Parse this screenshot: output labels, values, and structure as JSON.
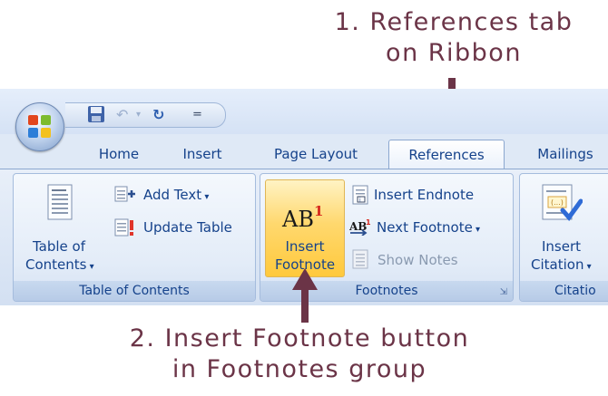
{
  "annotations": {
    "top_line1": "1. References tab",
    "top_line2": "on Ribbon",
    "bottom_line1": "2. Insert Footnote button",
    "bottom_line2": "in Footnotes group"
  },
  "qat": {
    "save_icon": "save-icon",
    "undo_icon": "undo-icon",
    "redo_icon": "redo-icon",
    "customize_glyph": "="
  },
  "tabs": [
    {
      "label": "Home"
    },
    {
      "label": "Insert"
    },
    {
      "label": "Page Layout"
    },
    {
      "label": "References"
    },
    {
      "label": "Mailings"
    }
  ],
  "active_tab": "References",
  "groups": {
    "toc": {
      "label": "Table of Contents",
      "toc_button_line1": "Table of",
      "toc_button_line2": "Contents",
      "add_text": "Add Text",
      "update_table": "Update Table"
    },
    "footnotes": {
      "label": "Footnotes",
      "insert_footnote_line1": "Insert",
      "insert_footnote_line2": "Footnote",
      "insert_footnote_icon_text": "AB",
      "insert_footnote_icon_sup": "1",
      "insert_endnote": "Insert Endnote",
      "next_footnote": "Next Footnote",
      "show_notes": "Show Notes"
    },
    "citations": {
      "label": "Citatio",
      "insert_citation_line1": "Insert",
      "insert_citation_line2": "Citation"
    }
  },
  "colors": {
    "annotation": "#6b3447",
    "ribbon_text": "#15428b",
    "highlight": "#ffd86e"
  }
}
